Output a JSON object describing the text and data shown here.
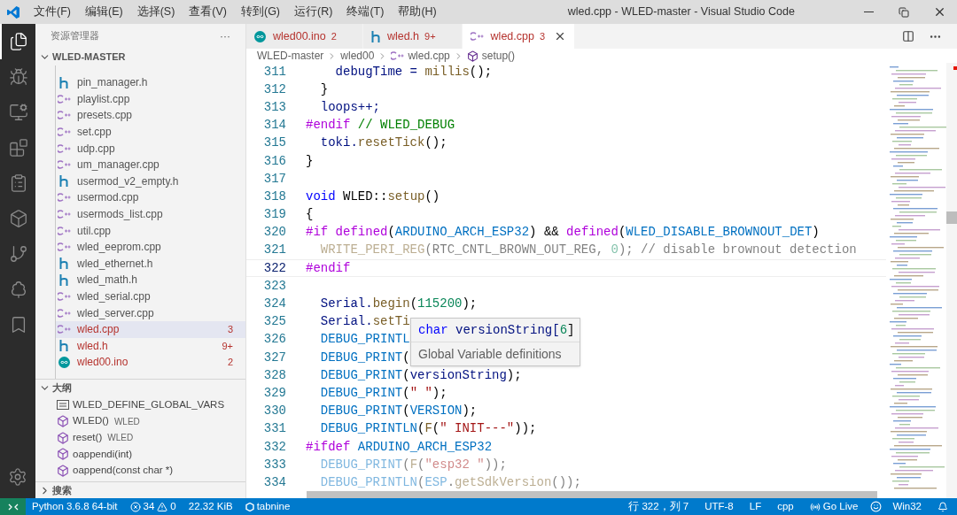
{
  "window": {
    "title": "wled.cpp - WLED-master - Visual Studio Code"
  },
  "menu": [
    "文件(F)",
    "编辑(E)",
    "选择(S)",
    "查看(V)",
    "转到(G)",
    "运行(R)",
    "终端(T)",
    "帮助(H)"
  ],
  "activity_bar": [
    {
      "kind": "files",
      "selected": true
    },
    {
      "kind": "debug",
      "selected": false
    },
    {
      "kind": "remote",
      "selected": false
    },
    {
      "kind": "extensions",
      "selected": false
    },
    {
      "kind": "clipboard",
      "selected": false
    },
    {
      "kind": "box",
      "selected": false
    },
    {
      "kind": "git",
      "selected": false
    },
    {
      "kind": "tree",
      "selected": false
    },
    {
      "kind": "bookmark",
      "selected": false
    }
  ],
  "sidebar": {
    "title": "资源管理器",
    "more": "···",
    "folder": {
      "name": "WLED-MASTER",
      "expanded": true,
      "files": [
        {
          "name": "pin_manager.h",
          "kind": "h",
          "selected": false
        },
        {
          "name": "playlist.cpp",
          "kind": "cpp",
          "selected": false
        },
        {
          "name": "presets.cpp",
          "kind": "cpp",
          "selected": false
        },
        {
          "name": "set.cpp",
          "kind": "cpp",
          "selected": false
        },
        {
          "name": "udp.cpp",
          "kind": "cpp",
          "selected": false
        },
        {
          "name": "um_manager.cpp",
          "kind": "cpp",
          "selected": false
        },
        {
          "name": "usermod_v2_empty.h",
          "kind": "h",
          "selected": false
        },
        {
          "name": "usermod.cpp",
          "kind": "cpp",
          "selected": false
        },
        {
          "name": "usermods_list.cpp",
          "kind": "cpp",
          "selected": false
        },
        {
          "name": "util.cpp",
          "kind": "cpp",
          "selected": false
        },
        {
          "name": "wled_eeprom.cpp",
          "kind": "cpp",
          "selected": false
        },
        {
          "name": "wled_ethernet.h",
          "kind": "h",
          "selected": false
        },
        {
          "name": "wled_math.h",
          "kind": "h",
          "selected": false
        },
        {
          "name": "wled_serial.cpp",
          "kind": "cpp",
          "selected": false
        },
        {
          "name": "wled_server.cpp",
          "kind": "cpp",
          "selected": false
        },
        {
          "name": "wled.cpp",
          "kind": "cpp",
          "selected": true,
          "badge": "3"
        },
        {
          "name": "wled.h",
          "kind": "h",
          "selected": false,
          "badge": "9+"
        },
        {
          "name": "wled00.ino",
          "kind": "ino",
          "selected": false,
          "badge": "2"
        }
      ]
    },
    "outline": {
      "title": "大纲",
      "expanded": true,
      "items": [
        {
          "name": "WLED_DEFINE_GLOBAL_VARS",
          "kind": "field"
        },
        {
          "name": "WLED()",
          "detail": "WLED",
          "kind": "method"
        },
        {
          "name": "reset()",
          "detail": "WLED",
          "kind": "method"
        },
        {
          "name": "oappendi(int)",
          "kind": "method"
        },
        {
          "name": "oappend(const char *)",
          "kind": "method"
        }
      ]
    },
    "search": {
      "title": "搜索",
      "expanded": false
    }
  },
  "tabs": [
    {
      "name": "wled00.ino",
      "kind": "ino",
      "badge": "2",
      "selected": false
    },
    {
      "name": "wled.h",
      "kind": "h",
      "badge": "9+",
      "selected": false
    },
    {
      "name": "wled.cpp",
      "kind": "cpp",
      "badge": "3",
      "selected": true
    }
  ],
  "breadcrumb": [
    {
      "text": "WLED-master",
      "kind": "folder"
    },
    {
      "text": "wled00",
      "kind": "folder"
    },
    {
      "text": "wled.cpp",
      "kind": "cpp"
    },
    {
      "text": "setup()",
      "kind": "method"
    }
  ],
  "code": [
    {
      "n": "311",
      "inactive": false,
      "current": false,
      "t": [
        {
          "text": "    debugTime = ",
          "kind": "v"
        },
        {
          "text": "millis",
          "kind": "f"
        },
        {
          "text": "();",
          "kind": "p"
        }
      ]
    },
    {
      "n": "312",
      "inactive": false,
      "current": false,
      "t": [
        {
          "text": "  }",
          "kind": "p"
        }
      ]
    },
    {
      "n": "313",
      "inactive": false,
      "current": false,
      "t": [
        {
          "text": "  loops++;",
          "kind": "v"
        }
      ]
    },
    {
      "n": "314",
      "inactive": false,
      "current": false,
      "t": [
        {
          "text": "#endif",
          "kind": "k"
        },
        {
          "text": " // WLED_DEBUG",
          "kind": "c"
        }
      ]
    },
    {
      "n": "315",
      "inactive": false,
      "current": false,
      "t": [
        {
          "text": "  toki.",
          "kind": "v"
        },
        {
          "text": "resetTick",
          "kind": "f"
        },
        {
          "text": "();",
          "kind": "p"
        }
      ]
    },
    {
      "n": "316",
      "inactive": false,
      "current": false,
      "t": [
        {
          "text": "}",
          "kind": "p"
        }
      ]
    },
    {
      "n": "317",
      "current": false
    },
    {
      "n": "318",
      "inactive": false,
      "current": false,
      "t": [
        {
          "text": "void",
          "kind": "b"
        },
        {
          "text": " WLED::",
          "kind": "p"
        },
        {
          "text": "setup",
          "kind": "f"
        },
        {
          "text": "()",
          "kind": "p"
        }
      ]
    },
    {
      "n": "319",
      "inactive": false,
      "current": false,
      "t": [
        {
          "text": "{",
          "kind": "p"
        }
      ]
    },
    {
      "n": "320",
      "inactive": false,
      "current": false,
      "t": [
        {
          "text": "#if",
          "kind": "k"
        },
        {
          "text": " defined",
          "kind": "k"
        },
        {
          "text": "(",
          "kind": "p"
        },
        {
          "text": "ARDUINO_ARCH_ESP32",
          "kind": "m"
        },
        {
          "text": ") && ",
          "kind": "p"
        },
        {
          "text": "defined",
          "kind": "k"
        },
        {
          "text": "(",
          "kind": "p"
        },
        {
          "text": "WLED_DISABLE_BROWNOUT_DET",
          "kind": "m"
        },
        {
          "text": ")",
          "kind": "p"
        }
      ]
    },
    {
      "n": "321",
      "inactive": true,
      "current": false,
      "t": [
        {
          "text": "  WRITE_PERI_REG",
          "kind": "f"
        },
        {
          "text": "(RTC_CNTL_BROWN_OUT_REG, ",
          "kind": "p"
        },
        {
          "text": "0",
          "kind": "num"
        },
        {
          "text": "); // disable brownout detection",
          "kind": "p"
        }
      ]
    },
    {
      "n": "322",
      "inactive": false,
      "current": true,
      "t": [
        {
          "text": "#endif",
          "kind": "k"
        }
      ]
    },
    {
      "n": "323",
      "current": false
    },
    {
      "n": "324",
      "inactive": false,
      "current": false,
      "t": [
        {
          "text": "  Serial.",
          "kind": "v"
        },
        {
          "text": "begin",
          "kind": "f"
        },
        {
          "text": "(",
          "kind": "p"
        },
        {
          "text": "115200",
          "kind": "num"
        },
        {
          "text": ");",
          "kind": "p"
        }
      ]
    },
    {
      "n": "325",
      "inactive": false,
      "current": false,
      "t": [
        {
          "text": "  Serial.",
          "kind": "v"
        },
        {
          "text": "setTi",
          "kind": "f"
        }
      ]
    },
    {
      "n": "326",
      "inactive": false,
      "current": false,
      "t": [
        {
          "text": "  DEBUG_PRINTL",
          "kind": "m"
        }
      ]
    },
    {
      "n": "327",
      "inactive": false,
      "current": false,
      "t": [
        {
          "text": "  DEBUG_PRINT",
          "kind": "m"
        },
        {
          "text": "(",
          "kind": "p"
        }
      ]
    },
    {
      "n": "328",
      "inactive": false,
      "current": false,
      "t": [
        {
          "text": "  DEBUG_PRINT",
          "kind": "m"
        },
        {
          "text": "(",
          "kind": "p"
        },
        {
          "text": "versionString",
          "kind": "v"
        },
        {
          "text": ");",
          "kind": "p"
        }
      ]
    },
    {
      "n": "329",
      "inactive": false,
      "current": false,
      "t": [
        {
          "text": "  DEBUG_PRINT",
          "kind": "m"
        },
        {
          "text": "(",
          "kind": "p"
        },
        {
          "text": "\" \"",
          "kind": "s"
        },
        {
          "text": ");",
          "kind": "p"
        }
      ]
    },
    {
      "n": "330",
      "inactive": false,
      "current": false,
      "t": [
        {
          "text": "  DEBUG_PRINT",
          "kind": "m"
        },
        {
          "text": "(",
          "kind": "p"
        },
        {
          "text": "VERSION",
          "kind": "m"
        },
        {
          "text": ");",
          "kind": "p"
        }
      ]
    },
    {
      "n": "331",
      "inactive": false,
      "current": false,
      "t": [
        {
          "text": "  DEBUG_PRINTLN",
          "kind": "m"
        },
        {
          "text": "(",
          "kind": "p"
        },
        {
          "text": "F",
          "kind": "f"
        },
        {
          "text": "(",
          "kind": "p"
        },
        {
          "text": "\" INIT---\"",
          "kind": "s"
        },
        {
          "text": "));",
          "kind": "p"
        }
      ]
    },
    {
      "n": "332",
      "inactive": false,
      "current": false,
      "t": [
        {
          "text": "#ifdef",
          "kind": "k"
        },
        {
          "text": " ARDUINO_ARCH_ESP32",
          "kind": "m"
        }
      ]
    },
    {
      "n": "333",
      "inactive": true,
      "current": false,
      "t": [
        {
          "text": "  DEBUG_PRINT",
          "kind": "m"
        },
        {
          "text": "(",
          "kind": "p"
        },
        {
          "text": "F",
          "kind": "f"
        },
        {
          "text": "(",
          "kind": "p"
        },
        {
          "text": "\"esp32 \"",
          "kind": "s"
        },
        {
          "text": "));",
          "kind": "p"
        }
      ]
    },
    {
      "n": "334",
      "inactive": true,
      "current": false,
      "t": [
        {
          "text": "  DEBUG_PRINTLN",
          "kind": "m"
        },
        {
          "text": "(",
          "kind": "p"
        },
        {
          "text": "ESP",
          "kind": "m"
        },
        {
          "text": ".",
          "kind": "p"
        },
        {
          "text": "getSdkVersion",
          "kind": "f"
        },
        {
          "text": "());",
          "kind": "p"
        }
      ]
    }
  ],
  "hover": {
    "signature": [
      {
        "text": "char",
        "kind": "b"
      },
      {
        "text": " versionString[",
        "kind": "v"
      },
      {
        "text": "6",
        "kind": "num"
      },
      {
        "text": "]",
        "kind": "p"
      }
    ],
    "doc": "Global Variable definitions"
  },
  "status_bar": {
    "python": "Python 3.6.8 64-bit",
    "errors": "34",
    "warnings": "0",
    "size": "22.32 KiB",
    "tabnine": "tabnine",
    "position": "行 322，列 7",
    "encoding": "UTF-8",
    "eol": "LF",
    "language": "cpp",
    "golive": "Go Live",
    "platform": "Win32"
  }
}
